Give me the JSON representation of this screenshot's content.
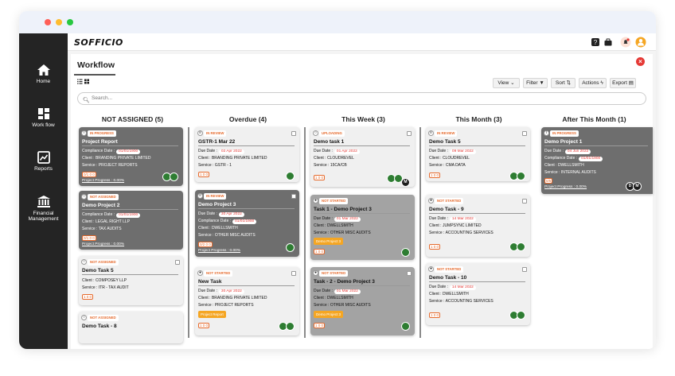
{
  "app": {
    "logo_text": "SOFFICIO",
    "colors": {
      "sidebar": "#242424",
      "accent": "#e66a2c",
      "close": "#e53935",
      "tag": "#f5a623"
    }
  },
  "sidebar": {
    "items": [
      {
        "label": "Home",
        "icon": "home-icon"
      },
      {
        "label": "Work flow",
        "icon": "grid-icon"
      },
      {
        "label": "Reports",
        "icon": "chart-icon"
      },
      {
        "label": "Financial Management",
        "label_line1": "Financial",
        "label_line2": "Management",
        "icon": "bank-icon"
      }
    ]
  },
  "page": {
    "title": "Workflow",
    "search_placeholder": "Search...",
    "toolbar": {
      "view": "View",
      "filter": "Filter",
      "sort": "Sort",
      "actions": "Actions",
      "export": "Export"
    }
  },
  "columns": [
    {
      "title": "NOT ASSIGNED (5)"
    },
    {
      "title": "Overdue (4)"
    },
    {
      "title": "This Week (3)"
    },
    {
      "title": "This Month (3)"
    },
    {
      "title": "After This Month (1)"
    }
  ],
  "cards": {
    "c1": {
      "status": "IN PROGRESS",
      "title": "Project Report",
      "compliance_label": "Compliance Date :",
      "compliance_date": "01/01/1900",
      "client": "Client : BRANDING PRIVATE LIMITED",
      "service": "Service : PROJECT REPORTS",
      "counts": "0/1  0  0",
      "progress": "Project Progress : 0.00%"
    },
    "c2": {
      "status": "NOT ASSIGNED",
      "title": "Demo Project 2",
      "compliance_label": "Compliance Date :",
      "compliance_date": "01/01/1900",
      "client": "Client : LEGAL RIGHT LLP",
      "service": "Service : TAX AUDITS",
      "counts": "0/1  0  0",
      "progress": "Project Progress : 0.00%"
    },
    "c3": {
      "status": "NOT ASSIGNED",
      "title": "Demo Task 5",
      "client": "Client : COMPOSEY LLP",
      "service": "Service : ITR - TAX AUDIT",
      "counts": "1  0  0"
    },
    "c4": {
      "status": "NOT ASSIGNED",
      "title": "Demo Task - 8"
    },
    "c5": {
      "status": "IN REVIEW",
      "title": "GSTR-1 Mar 22",
      "due_label": "Due Date :",
      "due_date": "02 Apr 2022",
      "client": "Client : BRANDING PRIVATE LIMITED",
      "service": "Service : GSTR - 1",
      "counts": "1  0  0"
    },
    "c6": {
      "status": "IN REVIEW",
      "title": "Demo Project 3",
      "due_label": "Due Date :",
      "due_date": "30 Apr 2022",
      "compliance_label": "Compliance Date :",
      "compliance_date": "01/01/1900",
      "client": "Client : DWELLSMITH",
      "service": "Service : OTHER MISC AUDITS",
      "counts": "0/2  0  0",
      "progress": "Project Progress : 0.00%"
    },
    "c7": {
      "status": "NOT STARTED",
      "title": "New Task",
      "due_label": "Due Date :",
      "due_date": "30 Apr 2022",
      "client": "Client : BRANDING PRIVATE LIMITED",
      "service": "Service : PROJECT REPORTS",
      "tag": "Project Report",
      "counts": "1  0  0"
    },
    "c8": {
      "status": "UPLOADING",
      "title": "Demo task 1",
      "due_label": "Due Date :",
      "due_date": "01 Apr 2022",
      "client": "Client : CLOUDREVEL",
      "service": "Service : 15CA/CB",
      "counts": "1  0  0"
    },
    "c9": {
      "status": "NOT STARTED",
      "title": "Task 1 - Demo Project 3",
      "due_label": "Due Date :",
      "due_date": "01 Mar 2022",
      "client": "Client : DWELLSMITH",
      "service": "Service : OTHER MISC AUDITS",
      "tag": "Demo Project 3",
      "counts": "1  0  0"
    },
    "c10": {
      "status": "NOT STARTED",
      "title": "Task - 2 - Demo Project 3",
      "due_label": "Due Date :",
      "due_date": "01 Mar 2022",
      "client": "Client : DWELLSMITH",
      "service": "Service : OTHER MISC AUDITS",
      "tag": "Demo Project 3",
      "counts": "1  0  0"
    },
    "c11": {
      "status": "IN REVIEW",
      "title": "Demo Task 5",
      "due_label": "Due Date :",
      "due_date": "09 Mar 2022",
      "client": "Client : CLOUDREVEL",
      "service": "Service : CMA DATA",
      "counts": "1  0  0"
    },
    "c12": {
      "status": "NOT STARTED",
      "title": "Demo Task - 9",
      "due_label": "Due Date :",
      "due_date": "14 Mar 2022",
      "client": "Client : JUMPSYNC LIMITED",
      "service": "Service : ACCOUNTING SERVICES",
      "counts": "1  0  0"
    },
    "c13": {
      "status": "NOT STARTED",
      "title": "Demo Task - 10",
      "due_label": "Due Date :",
      "due_date": "14 Mar 2022",
      "client": "Client : DWELLSMITH",
      "service": "Service : ACCOUNTING SERVICES",
      "counts": "1  0  0"
    },
    "c14": {
      "status": "IN PROGRESS",
      "title": "Demo Project 1",
      "due_label": "Due Date :",
      "due_date": "04 Jun 2022",
      "compliance_label": "Compliance Date :",
      "compliance_date": "01/01/1900",
      "client": "Client : DWELLSMITH",
      "service": "Service : INTERNAL AUDITS",
      "counts": "0/5",
      "progress": "Project Progress : 0.00%",
      "av1": "D",
      "av2": "M"
    }
  },
  "avatar_m": "M"
}
